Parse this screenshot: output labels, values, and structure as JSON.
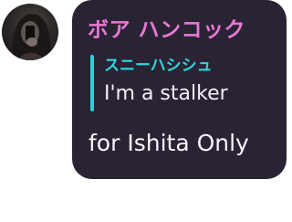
{
  "message": {
    "author_name": "ボア ハンコック",
    "reply": {
      "author_name": "スニーハシシュ",
      "text": "I'm a stalker"
    },
    "text": "for Ishita Only",
    "avatar_icon": "user-photo-avatar"
  },
  "colors": {
    "bubble_background": "#2a2334",
    "author_name": "#e879d6",
    "reply_accent": "#2ed0d8",
    "text": "#f7f5fa"
  }
}
